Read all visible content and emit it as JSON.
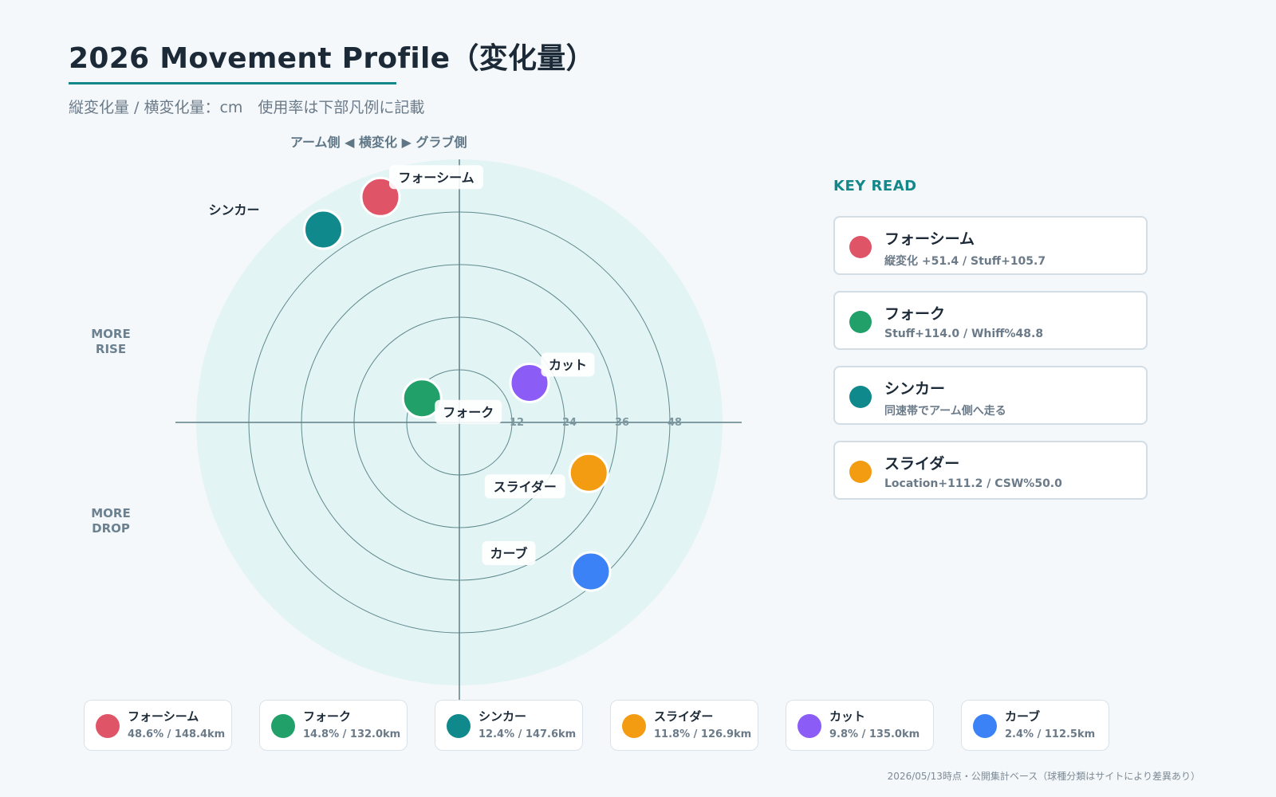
{
  "header": {
    "title": "2026 Movement Profile（変化量）",
    "subtitle": "縦変化量 / 横変化量：cm　使用率は下部凡例に記載"
  },
  "axis_labels": {
    "top": "アーム側 ◀ 横変化 ▶ グラブ側",
    "left_upper": "MORE\nRISE",
    "left_lower": "MORE\nDROP"
  },
  "colors": {
    "accent": "#13888a",
    "four_seam": "#e05468",
    "fork": "#21a06a",
    "sinker": "#10898c",
    "slider": "#f39c12",
    "cutter": "#8b5cf6",
    "curve": "#3b82f6",
    "plot_bg": "#e3f4f4"
  },
  "chart_data": {
    "type": "scatter",
    "title": "2026 Movement Profile（変化量）",
    "xlabel": "アーム側 ◀ 横変化 ▶ グラブ側",
    "ylabel": "",
    "units": "cm",
    "rings": [
      12,
      24,
      36,
      48
    ],
    "grid": true,
    "points": [
      {
        "name": "フォーシーム",
        "x": -18,
        "y": 51.4,
        "color": "#e05468"
      },
      {
        "name": "シンカー",
        "x": -31,
        "y": 44.0,
        "color": "#10898c"
      },
      {
        "name": "カット",
        "x": 16,
        "y": 9.0,
        "color": "#8b5cf6"
      },
      {
        "name": "フォーク",
        "x": -8.5,
        "y": 5.5,
        "color": "#21a06a"
      },
      {
        "name": "スライダー",
        "x": 29.5,
        "y": -11.5,
        "color": "#f39c12"
      },
      {
        "name": "カーブ",
        "x": 30,
        "y": -34,
        "color": "#3b82f6"
      }
    ]
  },
  "key_read": {
    "heading": "KEY READ",
    "items": [
      {
        "name": "フォーシーム",
        "detail": "縦変化 +51.4 / Stuff+105.7",
        "color": "#e05468"
      },
      {
        "name": "フォーク",
        "detail": "Stuff+114.0 / Whiff%48.8",
        "color": "#21a06a"
      },
      {
        "name": "シンカー",
        "detail": "同速帯でアーム側へ走る",
        "color": "#10898c"
      },
      {
        "name": "スライダー",
        "detail": "Location+111.2 / CSW%50.0",
        "color": "#f39c12"
      }
    ]
  },
  "legend": [
    {
      "name": "フォーシーム",
      "detail": "48.6% / 148.4km",
      "color": "#e05468"
    },
    {
      "name": "フォーク",
      "detail": "14.8% / 132.0km",
      "color": "#21a06a"
    },
    {
      "name": "シンカー",
      "detail": "12.4% / 147.6km",
      "color": "#10898c"
    },
    {
      "name": "スライダー",
      "detail": "11.8% / 126.9km",
      "color": "#f39c12"
    },
    {
      "name": "カット",
      "detail": "9.8% / 135.0km",
      "color": "#8b5cf6"
    },
    {
      "name": "カーブ",
      "detail": "2.4% / 112.5km",
      "color": "#3b82f6"
    }
  ],
  "footnote": "2026/05/13時点・公開集計ベース（球種分類はサイトにより差異あり）"
}
